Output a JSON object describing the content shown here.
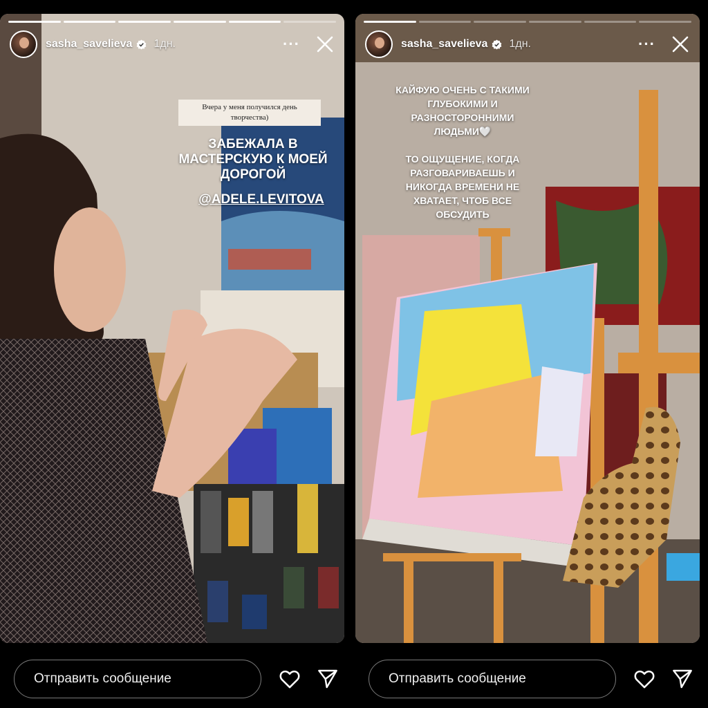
{
  "stories": [
    {
      "username": "sasha_savelieva",
      "time": "1дн.",
      "caption": "Вчера у меня получился день творчества)",
      "text": "ЗАБЕЖАЛА В\nМАСТЕРСКУЮ К МОЕЙ\nДОРОГОЙ",
      "mention": "@ADELE.LEVITOVA"
    },
    {
      "username": "sasha_savelieva",
      "time": "1дн.",
      "text": "КАЙФУЮ ОЧЕНЬ С ТАКИМИ\nГЛУБОКИМИ И\nРАЗНОСТОРОННИМИ\nЛЮДЬМИ🤍\n\nТО ОЩУЩЕНИЕ, КОГДА\nРАЗГОВАРИВАЕШЬ И\nНИКОГДА ВРЕМЕНИ НЕ\nХВАТАЕТ, ЧТОБ ВСЕ\nОБСУДИТЬ"
    }
  ],
  "reply": {
    "placeholder": "Отправить сообщение"
  },
  "icons": {
    "more": "more-icon",
    "close": "close-icon",
    "heart": "heart-icon",
    "send": "send-icon",
    "verified": "verified-badge-icon"
  },
  "colors": {
    "background": "#000000",
    "text": "#ffffff",
    "verified": "#ffffff"
  }
}
